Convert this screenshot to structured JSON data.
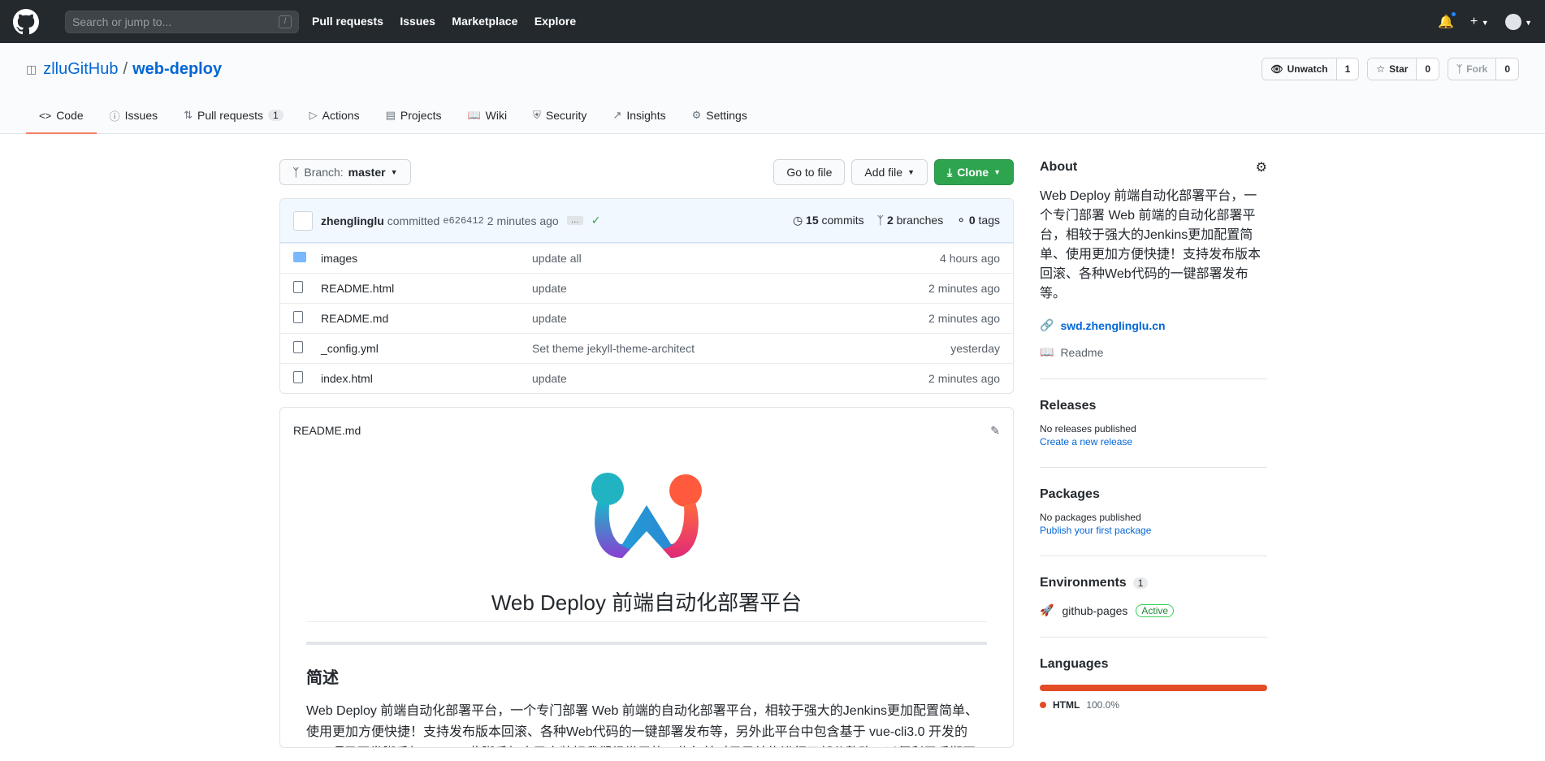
{
  "header": {
    "search_placeholder": "Search or jump to...",
    "slash": "/",
    "nav": [
      "Pull requests",
      "Issues",
      "Marketplace",
      "Explore"
    ]
  },
  "repo": {
    "owner": "zlluGitHub",
    "name": "web-deploy",
    "separator": "/",
    "unwatch_label": "Unwatch",
    "watch_count": "1",
    "star_label": "Star",
    "star_count": "0",
    "fork_label": "Fork",
    "fork_count": "0"
  },
  "tabs": [
    {
      "label": "Code",
      "icon": "code-icon"
    },
    {
      "label": "Issues",
      "icon": "issue-icon"
    },
    {
      "label": "Pull requests",
      "icon": "pr-icon",
      "count": "1"
    },
    {
      "label": "Actions",
      "icon": "play-icon"
    },
    {
      "label": "Projects",
      "icon": "project-icon"
    },
    {
      "label": "Wiki",
      "icon": "book-icon"
    },
    {
      "label": "Security",
      "icon": "shield-icon"
    },
    {
      "label": "Insights",
      "icon": "graph-icon"
    },
    {
      "label": "Settings",
      "icon": "gear-icon"
    }
  ],
  "toolbar": {
    "branch_prefix": "Branch:",
    "branch": "master",
    "goto_file": "Go to file",
    "add_file": "Add file",
    "clone": "Clone"
  },
  "commit": {
    "author": "zhenglinglu",
    "verb": "committed",
    "sha": "e626412",
    "time": "2 minutes ago",
    "ellipsis": "…",
    "commits_count": "15",
    "commits_label": "commits",
    "branches_count": "2",
    "branches_label": "branches",
    "tags_count": "0",
    "tags_label": "tags"
  },
  "files": [
    {
      "name": "images",
      "type": "dir",
      "message": "update all",
      "age": "4 hours ago"
    },
    {
      "name": "README.html",
      "type": "file",
      "message": "update",
      "age": "2 minutes ago"
    },
    {
      "name": "README.md",
      "type": "file",
      "message": "update",
      "age": "2 minutes ago"
    },
    {
      "name": "_config.yml",
      "type": "file",
      "message": "Set theme jekyll-theme-architect",
      "age": "yesterday"
    },
    {
      "name": "index.html",
      "type": "file",
      "message": "update",
      "age": "2 minutes ago"
    }
  ],
  "readme": {
    "filename": "README.md",
    "title": "Web Deploy 前端自动化部署平台",
    "h2": "简述",
    "paragraph": "Web Deploy 前端自动化部署平台，一个专门部署 Web 前端的自动化部署平台，相较于强大的Jenkins更加配置简单、使用更加方便快捷！支持发布版本回滚、各种Web代码的一键部署发布等，另外此平台中包含基于 vue-cli3.0 开发的 vue 项目开发脚手架 swt-cli ,此脚手架中已安装好我们经常用的一些包并对目录结构进行了部分整改，以便利于后期开发。若有任何疑问欢迎在 issues 留言，一起讨论。本项目持续更新中……%"
  },
  "about": {
    "title": "About",
    "description": "Web Deploy 前端自动化部署平台，一个专门部署 Web 前端的自动化部署平台，相较于强大的Jenkins更加配置简单、使用更加方便快捷！支持发布版本回滚、各种Web代码的一键部署发布等。",
    "link": "swd.zhenglinglu.cn",
    "readme": "Readme"
  },
  "releases": {
    "title": "Releases",
    "none": "No releases published",
    "create": "Create a new release"
  },
  "packages": {
    "title": "Packages",
    "none": "No packages published",
    "publish": "Publish your first package"
  },
  "environments": {
    "title": "Environments",
    "count": "1",
    "name": "github-pages",
    "status": "Active"
  },
  "languages": {
    "title": "Languages",
    "name": "HTML",
    "percent": "100.0%",
    "color": "#e34c26"
  }
}
